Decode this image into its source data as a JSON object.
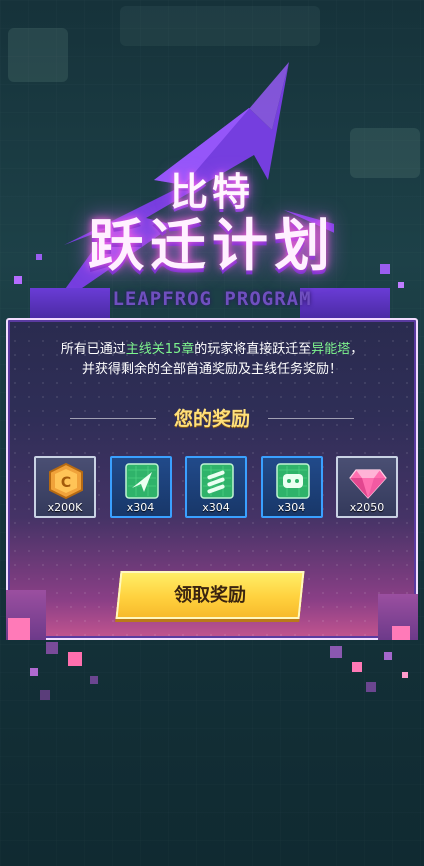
{
  "title": {
    "line1": "比特",
    "line2": "跃迁计划",
    "subtitle": "LEAPFROG PROGRAM"
  },
  "description": {
    "line1_pre": "所有已通过",
    "line1_hl1": "主线关15章",
    "line1_mid": "的玩家将直接跃迁至",
    "line1_hl2": "异能塔",
    "line1_post": "，",
    "line2": "并获得剩余的全部首通奖励及主线任务奖励！"
  },
  "rewards": {
    "title": "您的奖励",
    "items": [
      {
        "icon": "gold-coin-icon",
        "qty": "x200K"
      },
      {
        "icon": "green-card-plane-icon",
        "qty": "x304"
      },
      {
        "icon": "green-card-missiles-icon",
        "qty": "x304"
      },
      {
        "icon": "green-card-drone-icon",
        "qty": "x304"
      },
      {
        "icon": "pink-diamond-icon",
        "qty": "x2050"
      }
    ]
  },
  "claim_button": {
    "label": "领取奖励"
  },
  "colors": {
    "highlight": "#7ef58e",
    "reward_title": "#ffe07a",
    "button": "#ffd13e",
    "bolt": "#7a3ee8"
  }
}
